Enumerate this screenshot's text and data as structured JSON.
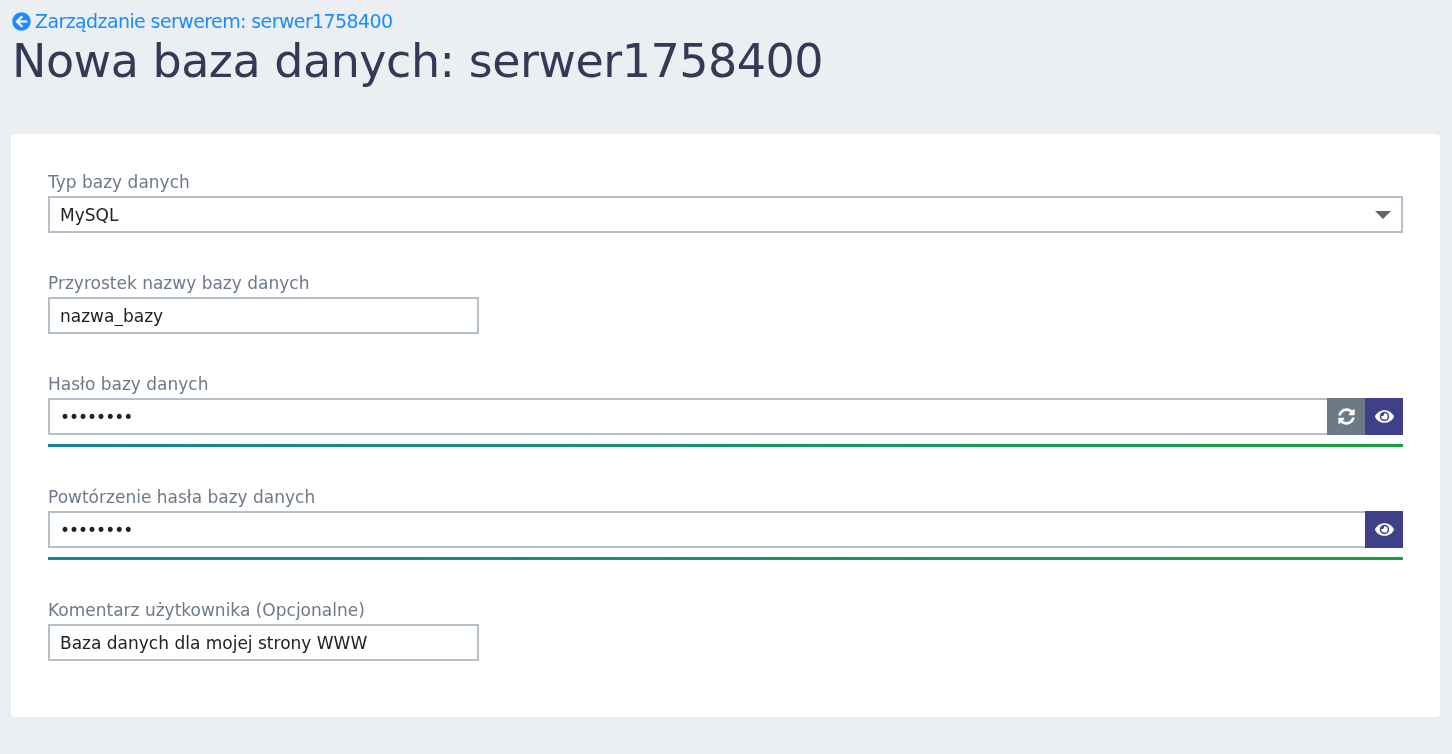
{
  "breadcrumb": {
    "label": "Zarządzanie serwerem: serwer1758400"
  },
  "title": "Nowa baza danych: serwer1758400",
  "fields": [
    {
      "kind": "select",
      "label": "Typ bazy danych",
      "value": "MySQL"
    },
    {
      "kind": "text",
      "label": "Przyrostek nazwy bazy danych",
      "value": "nazwa_bazy"
    },
    {
      "kind": "password",
      "label": "Hasło bazy danych",
      "value": "••••••••",
      "buttons": [
        {
          "kind": "regenerate"
        },
        {
          "kind": "reveal"
        }
      ],
      "level": 1
    },
    {
      "kind": "password",
      "label": "Powtórzenie hasła bazy danych",
      "value": "••••••••",
      "buttons": [
        {
          "kind": "reveal"
        }
      ],
      "level": 1
    },
    {
      "kind": "text",
      "label": "Komentarz użytkownika (Opcjonalne)",
      "value": "Baza danych dla mojej strony WWW"
    }
  ]
}
